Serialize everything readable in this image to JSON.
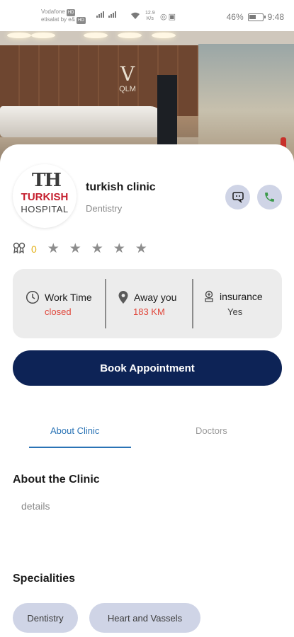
{
  "status_bar": {
    "carrier1": "Vodafone",
    "carrier1_tag": "HD",
    "carrier2": "etisalat by e&",
    "carrier2_tag": "HD",
    "net_speed_value": "12.9",
    "net_speed_unit": "K/s",
    "battery": "46%",
    "time": "9:48"
  },
  "hero": {
    "sign_text": "QLM"
  },
  "clinic": {
    "logo_initials_a": "T",
    "logo_initials_b": "H",
    "logo_line1": "TURKISH",
    "logo_line2": "HOSPITAL",
    "name": "turkish clinic",
    "category": "Dentistry"
  },
  "rating": {
    "count": "0",
    "stars": [
      "★",
      "★",
      "★",
      "★",
      "★"
    ]
  },
  "info": {
    "work_time_label": "Work Time",
    "work_time_value": "closed",
    "distance_label": "Away you",
    "distance_value": "183 KM",
    "insurance_label": "insurance",
    "insurance_value": "Yes"
  },
  "book_button": "Book Appointment",
  "tabs": {
    "about": "About Clinic",
    "doctors": "Doctors",
    "active": "about"
  },
  "about": {
    "heading": "About the Clinic",
    "details": "details"
  },
  "specialities": {
    "heading": "Specialities",
    "items": [
      "Dentistry",
      "Heart and Vassels"
    ]
  },
  "colors": {
    "primary": "#0d2356",
    "accent_red": "#e0463a",
    "tab_active": "#2a73b5",
    "chip_bg": "#cfd4e6",
    "rating_count": "#e3b018",
    "phone_green": "#3c9a4b"
  }
}
